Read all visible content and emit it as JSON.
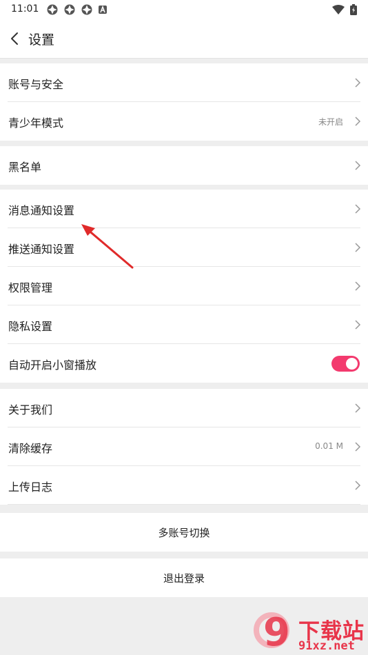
{
  "status_bar": {
    "time": "11:01"
  },
  "header": {
    "title": "设置"
  },
  "groups": [
    {
      "items": [
        {
          "label": "账号与安全"
        },
        {
          "label": "青少年模式",
          "value": "未开启"
        }
      ]
    },
    {
      "items": [
        {
          "label": "黑名单"
        }
      ]
    },
    {
      "items": [
        {
          "label": "消息通知设置"
        },
        {
          "label": "推送通知设置"
        },
        {
          "label": "权限管理"
        },
        {
          "label": "隐私设置"
        },
        {
          "label": "自动开启小窗播放",
          "toggle_on": true
        }
      ]
    },
    {
      "items": [
        {
          "label": "关于我们"
        },
        {
          "label": "清除缓存",
          "value": "0.01 M"
        },
        {
          "label": "上传日志"
        }
      ]
    }
  ],
  "buttons": {
    "switch_account": "多账号切换",
    "logout": "退出登录"
  },
  "colors": {
    "accent": "#f33a6e",
    "annotation_arrow": "#e02a2a"
  },
  "watermark": {
    "brand": "下载站",
    "url": "91xz.net",
    "logo_glyph": "9"
  }
}
